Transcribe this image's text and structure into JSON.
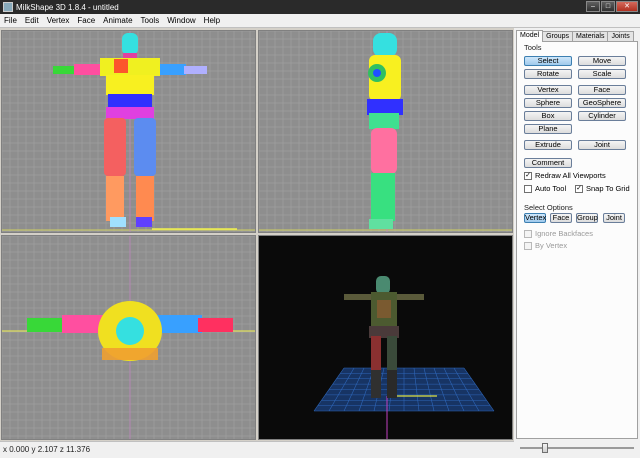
{
  "window": {
    "title": "MilkShape 3D 1.8.4 - untitled",
    "minimize": "–",
    "maximize": "□",
    "close": "✕"
  },
  "menu": [
    "File",
    "Edit",
    "Vertex",
    "Face",
    "Animate",
    "Tools",
    "Window",
    "Help"
  ],
  "status": {
    "coords": "x 0.000 y 2.107 z 11.376"
  },
  "tabs": [
    {
      "label": "Model",
      "active": true
    },
    {
      "label": "Groups",
      "active": false
    },
    {
      "label": "Materials",
      "active": false
    },
    {
      "label": "Joints",
      "active": false
    }
  ],
  "tools": {
    "heading": "Tools",
    "buttons": [
      {
        "label": "Select",
        "selected": true
      },
      {
        "label": "Move",
        "selected": false
      },
      {
        "label": "Rotate",
        "selected": false
      },
      {
        "label": "Scale",
        "selected": false
      },
      {
        "label": "Vertex",
        "selected": false
      },
      {
        "label": "Face",
        "selected": false
      },
      {
        "label": "Sphere",
        "selected": false
      },
      {
        "label": "GeoSphere",
        "selected": false
      },
      {
        "label": "Box",
        "selected": false
      },
      {
        "label": "Cylinder",
        "selected": false
      },
      {
        "label": "Plane",
        "selected": false
      },
      {
        "label": "Extrude",
        "selected": false
      },
      {
        "label": "Joint",
        "selected": false
      },
      {
        "label": "Comment",
        "selected": false
      }
    ],
    "checks": [
      {
        "label": "Redraw All Viewports",
        "checked": true
      },
      {
        "label": "Auto Tool",
        "checked": false
      },
      {
        "label": "Snap To Grid",
        "checked": true
      }
    ]
  },
  "select_options": {
    "heading": "Select Options",
    "buttons": [
      {
        "label": "Vertex",
        "selected": true
      },
      {
        "label": "Face",
        "selected": false
      },
      {
        "label": "Group",
        "selected": false
      },
      {
        "label": "Joint",
        "selected": false
      }
    ],
    "checks": [
      {
        "label": "Ignore Backfaces",
        "checked": false,
        "enabled": false
      },
      {
        "label": "By Vertex",
        "checked": false,
        "enabled": false
      }
    ]
  },
  "slider": {
    "value": 0.2
  },
  "colors": {
    "viewport_bg": "#8e8e8e",
    "grid": "#a6a6a6",
    "perspective_bg": "#0a0a0a",
    "perspective_grid": "#2e66b8"
  }
}
